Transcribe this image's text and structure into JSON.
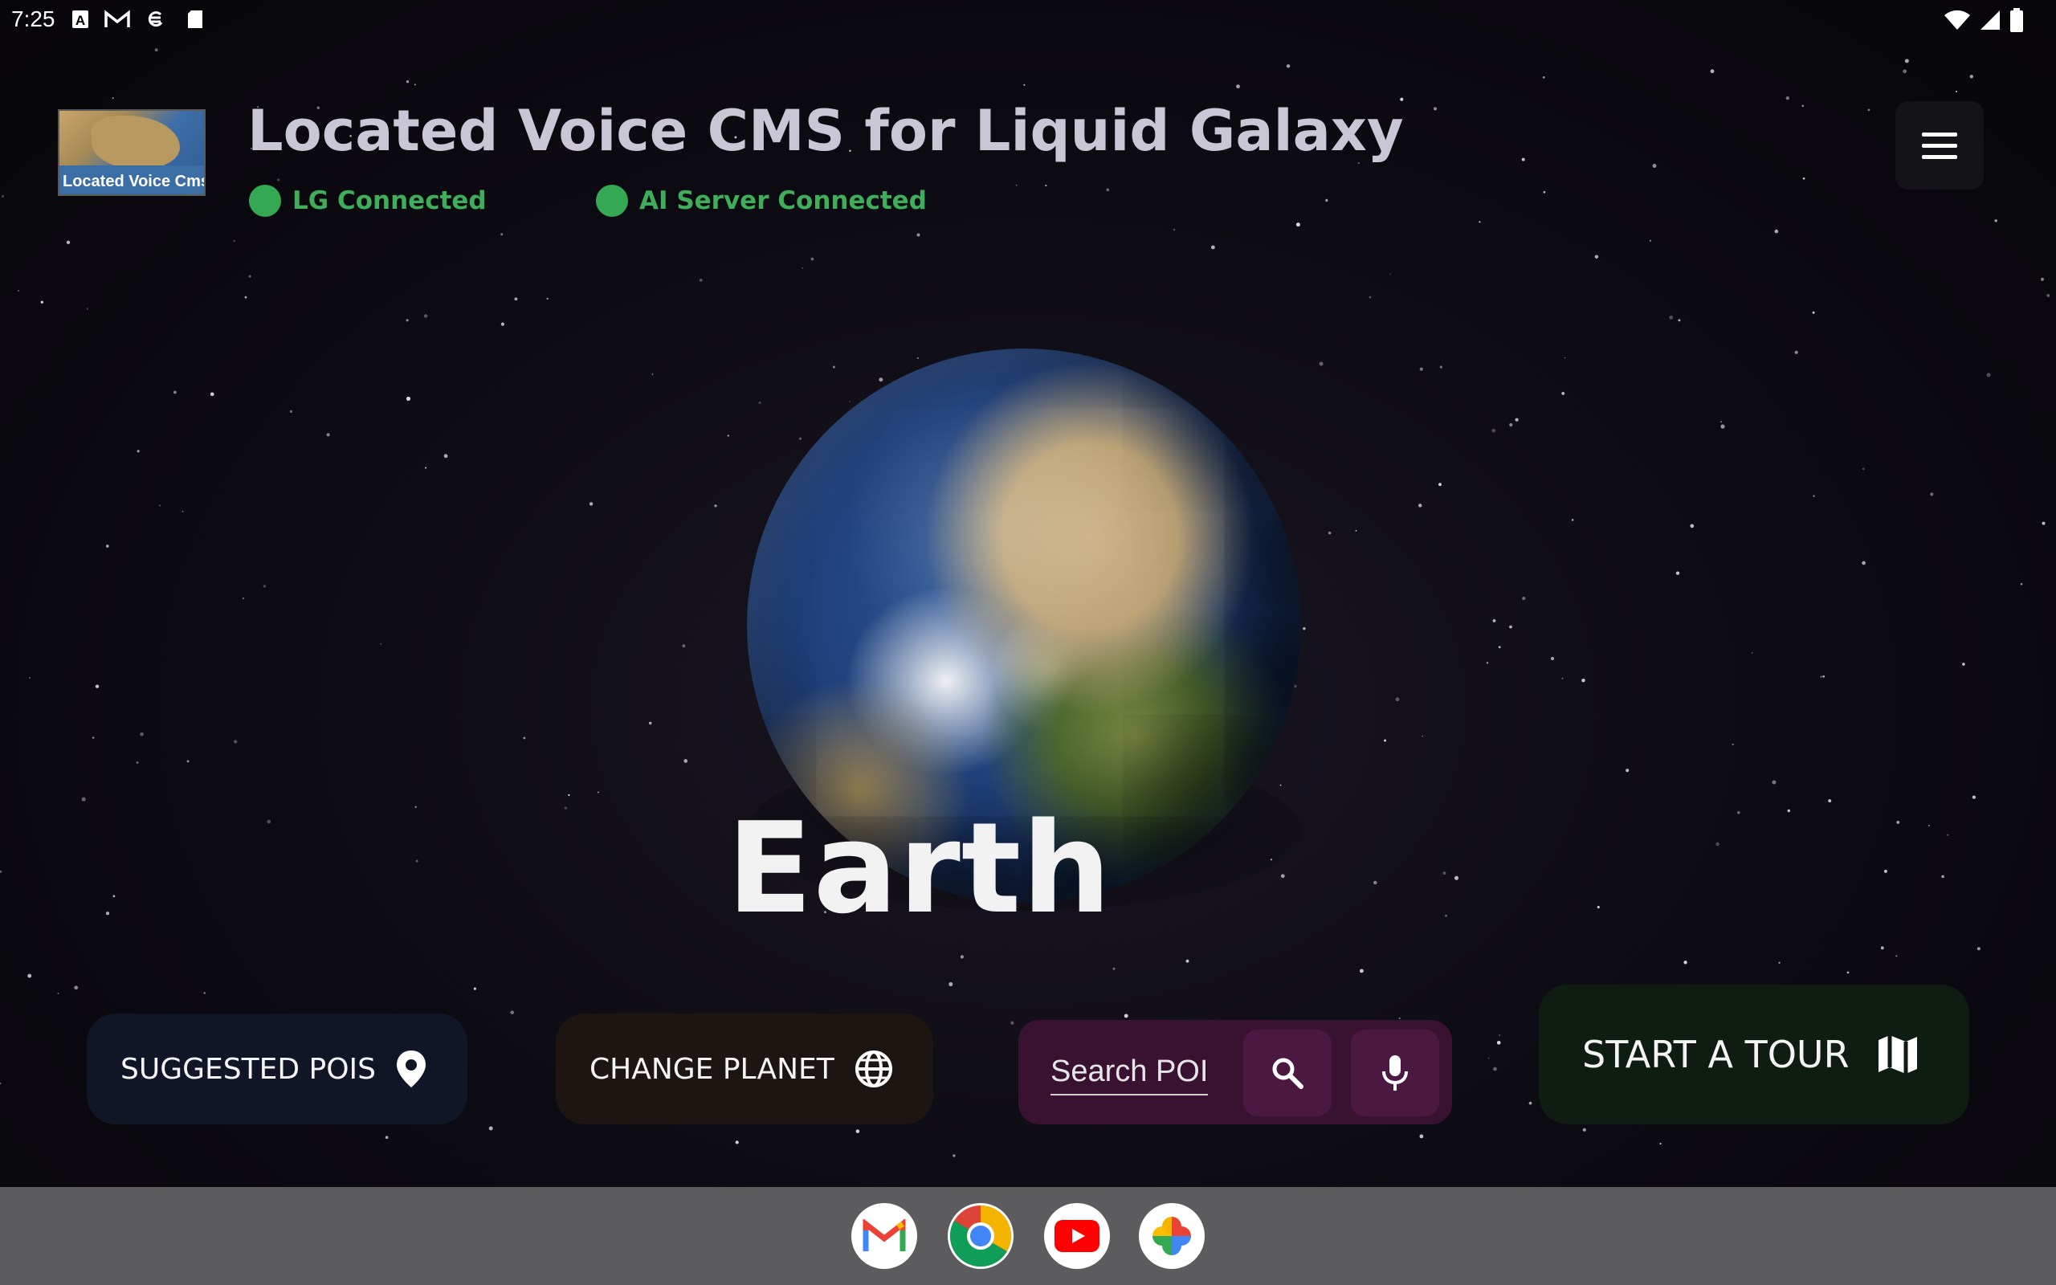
{
  "status_bar": {
    "time": "7:25",
    "left_icons": [
      "text-a-icon",
      "gmail-icon",
      "sync-icon",
      "sdcard-icon"
    ],
    "right_icons": [
      "wifi-icon",
      "signal-icon",
      "battery-icon"
    ]
  },
  "header": {
    "app_title": "Located Voice CMS for Liquid Galaxy",
    "logo_text": "Located Voice Cms for",
    "lg_status": "LG Connected",
    "ai_status": "AI Server Connected",
    "status_color": "#34a853"
  },
  "main": {
    "planet_name": "Earth"
  },
  "actions": {
    "suggested_pois": "SUGGESTED POIS",
    "change_planet": "CHANGE PLANET",
    "search_placeholder": "Search POI",
    "start_tour": "START A TOUR"
  },
  "dock": {
    "apps": [
      "Gmail",
      "Chrome",
      "YouTube",
      "Photos"
    ]
  },
  "colors": {
    "suggest_bg": "#111626",
    "planet_bg": "#1d1512",
    "search_bg": "#3a1231",
    "tour_bg": "#0f1c12",
    "accent_green": "#34a853"
  }
}
